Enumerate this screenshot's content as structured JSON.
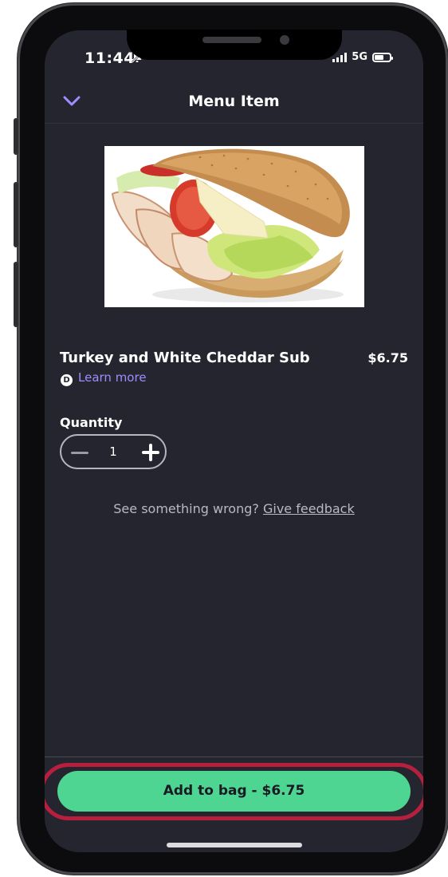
{
  "status_bar": {
    "time": "11:44",
    "network": "5G"
  },
  "header": {
    "title": "Menu Item"
  },
  "item": {
    "name": "Turkey and White Cheddar Sub",
    "price": "$6.75",
    "badge": "D",
    "learn_more": "Learn more"
  },
  "quantity": {
    "label": "Quantity",
    "value": "1"
  },
  "feedback": {
    "text": "See something wrong?",
    "link": "Give feedback"
  },
  "cta": {
    "label": "Add to bag - $6.75"
  },
  "colors": {
    "background": "#25252f",
    "accent_purple": "#9f8cff",
    "cta_green": "#4ed592",
    "highlight_red": "#b61f3e"
  }
}
